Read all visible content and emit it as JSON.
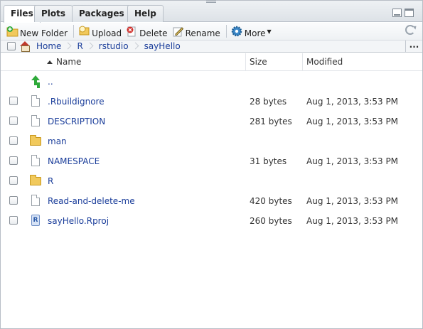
{
  "tabs": [
    {
      "label": "Files",
      "active": true
    },
    {
      "label": "Plots",
      "active": false
    },
    {
      "label": "Packages",
      "active": false
    },
    {
      "label": "Help",
      "active": false
    }
  ],
  "toolbar": {
    "new_folder": "New Folder",
    "upload": "Upload",
    "delete": "Delete",
    "rename": "Rename",
    "more": "More"
  },
  "breadcrumb": [
    "Home",
    "R",
    "rstudio",
    "sayHello"
  ],
  "columns": {
    "name": "Name",
    "size": "Size",
    "modified": "Modified"
  },
  "parent_link": "..",
  "files": [
    {
      "name": ".Rbuildignore",
      "icon": "document-icon",
      "size": "28 bytes",
      "modified": "Aug 1, 2013, 3:53 PM"
    },
    {
      "name": "DESCRIPTION",
      "icon": "document-icon",
      "size": "281 bytes",
      "modified": "Aug 1, 2013, 3:53 PM"
    },
    {
      "name": "man",
      "icon": "folder-icon",
      "size": "",
      "modified": ""
    },
    {
      "name": "NAMESPACE",
      "icon": "document-icon",
      "size": "31 bytes",
      "modified": "Aug 1, 2013, 3:53 PM"
    },
    {
      "name": "R",
      "icon": "folder-icon",
      "size": "",
      "modified": ""
    },
    {
      "name": "Read-and-delete-me",
      "icon": "document-icon",
      "size": "420 bytes",
      "modified": "Aug 1, 2013, 3:53 PM"
    },
    {
      "name": "sayHello.Rproj",
      "icon": "rproject-icon",
      "size": "260 bytes",
      "modified": "Aug 1, 2013, 3:53 PM"
    }
  ],
  "colors": {
    "link": "#1a3d9a",
    "tab_bg": "#dfe4e9",
    "folder": "#f1c95c",
    "up_arrow": "#2eaa3a"
  }
}
